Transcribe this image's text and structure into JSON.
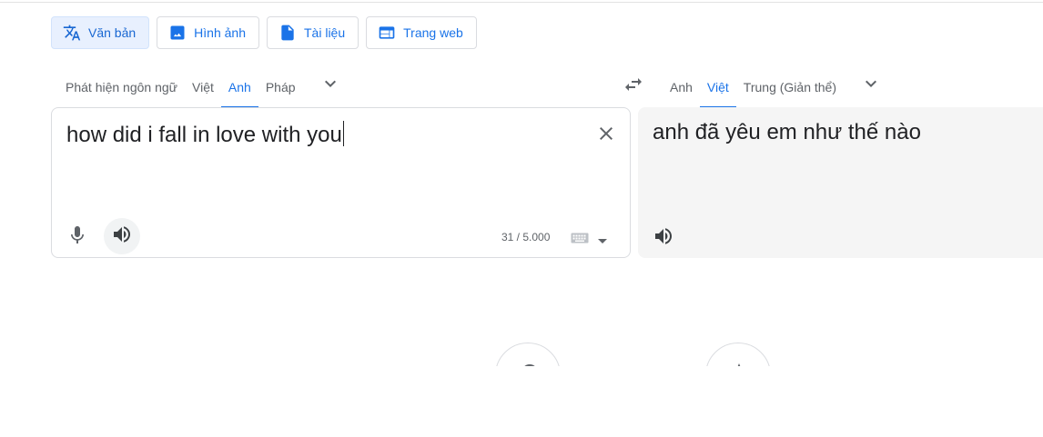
{
  "modes": [
    {
      "label": "Văn bản",
      "icon": "translate-icon",
      "active": true
    },
    {
      "label": "Hình ảnh",
      "icon": "image-icon",
      "active": false
    },
    {
      "label": "Tài liệu",
      "icon": "document-icon",
      "active": false
    },
    {
      "label": "Trang web",
      "icon": "web-icon",
      "active": false
    }
  ],
  "source_langs": [
    "Phát hiện ngôn ngữ",
    "Việt",
    "Anh",
    "Pháp"
  ],
  "source_active": "Anh",
  "target_langs": [
    "Anh",
    "Việt",
    "Trung (Giản thể)"
  ],
  "target_active": "Việt",
  "source": {
    "text": "how did i fall in love with you",
    "char_count": "31 / 5.000"
  },
  "target": {
    "text": "anh đã yêu em như thế nào"
  },
  "colors": {
    "accent": "#1a73e8",
    "active_bg": "#e8f0fe",
    "target_bg": "#f5f5f5"
  }
}
